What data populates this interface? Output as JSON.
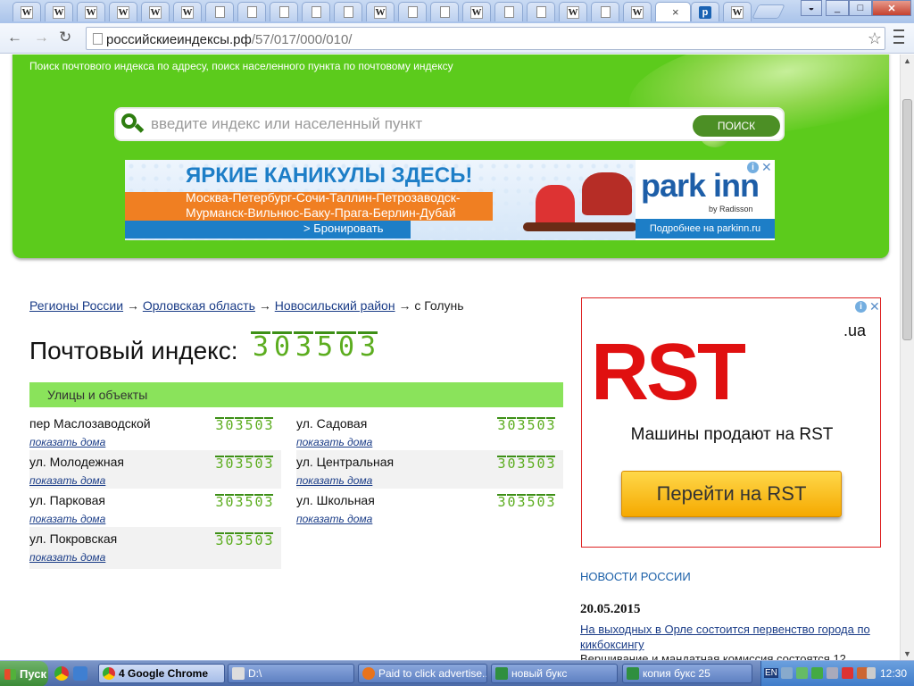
{
  "browser": {
    "tabs_close": "×",
    "url_host": "российскиеиндексы.рф",
    "url_path": "/57/017/000/010/",
    "window_buttons": [
      "_",
      "□",
      "✕"
    ]
  },
  "site": {
    "tagline": "Поиск почтового индекса по адресу, поиск населенного пункта по почтовому индексу",
    "search_placeholder": "введите индекс или населенный пункт",
    "search_button": "ПОИСК"
  },
  "banner": {
    "headline": "ЯРКИЕ КАНИКУЛЫ ЗДЕСЬ!",
    "line1": "Москва-Петербург-Сочи-Таллин-Петрозаводск-",
    "line2": "Мурманск-Вильнюс-Баку-Прага-Берлин-Дубай",
    "book": "> Бронировать",
    "brand": "park inn",
    "brand_sub": "by Radisson",
    "details": "Подробнее на parkinn.ru"
  },
  "breadcrumbs": {
    "item1": "Регионы России",
    "item2": "Орловская область",
    "item3": "Новосильский район",
    "current": "с Голунь",
    "sep": "→"
  },
  "postcode": {
    "label": "Почтовый индекс:",
    "digits": [
      "3",
      "0",
      "3",
      "5",
      "0",
      "3"
    ]
  },
  "streets": {
    "heading": "Улицы и объекты",
    "show_houses": "показать дома",
    "items": [
      {
        "name": "пер Маслозаводской",
        "code": [
          "3",
          "0",
          "3",
          "5",
          "0",
          "3"
        ]
      },
      {
        "name": "ул. Садовая",
        "code": [
          "3",
          "0",
          "3",
          "5",
          "0",
          "3"
        ]
      },
      {
        "name": "ул. Молодежная",
        "code": [
          "3",
          "0",
          "3",
          "5",
          "0",
          "3"
        ]
      },
      {
        "name": "ул. Центральная",
        "code": [
          "3",
          "0",
          "3",
          "5",
          "0",
          "3"
        ]
      },
      {
        "name": "ул. Парковая",
        "code": [
          "3",
          "0",
          "3",
          "5",
          "0",
          "3"
        ]
      },
      {
        "name": "ул. Школьная",
        "code": [
          "3",
          "0",
          "3",
          "5",
          "0",
          "3"
        ]
      },
      {
        "name": "ул. Покровская",
        "code": [
          "3",
          "0",
          "3",
          "5",
          "0",
          "3"
        ]
      }
    ]
  },
  "rst_ad": {
    "ua": ".ua",
    "logo": "RST",
    "message": "Машины продают на RST",
    "button": "Перейти на RST"
  },
  "news": {
    "heading": "НОВОСТИ РОССИИ",
    "date": "20.05.2015",
    "item1": "На выходных в Орле состоится первенство города по кикбоксингу",
    "item2": "Вершивание и мандатная комиссия состоятся 12"
  },
  "taskbar": {
    "start": "Пуск",
    "tasks": [
      "4 Google Chrome",
      "D:\\",
      "Paid to click advertise...",
      "новый букс",
      "копия букс 25"
    ],
    "lang": "EN",
    "clock": "12:30"
  },
  "colors": {
    "header_green": "#5ccb1c",
    "streets_bar": "#8ae35b",
    "digit_green": "#5cad1f",
    "link_blue": "#1a3c87",
    "rst_red": "#e01010"
  }
}
